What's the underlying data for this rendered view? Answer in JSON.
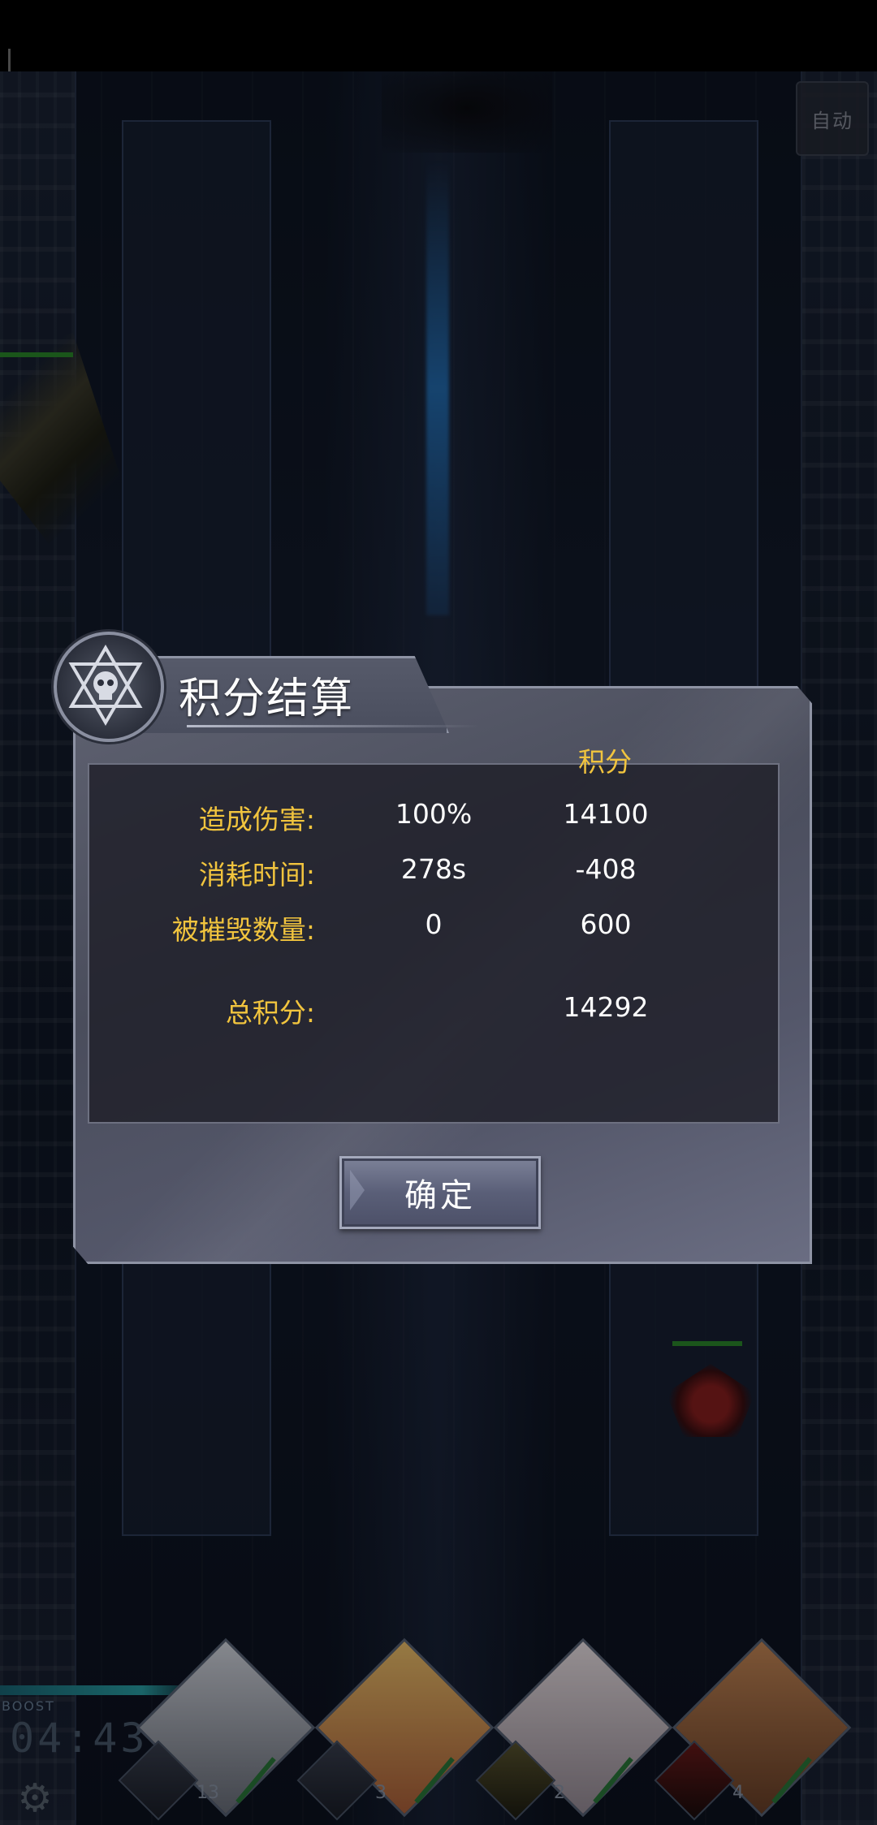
{
  "hud": {
    "auto_label": "自动",
    "boost_label": "BOOST",
    "timer": "04:43",
    "settings_icon": "gear-icon"
  },
  "party": [
    {
      "count": "13"
    },
    {
      "count": "3"
    },
    {
      "count": "2"
    },
    {
      "count": "4"
    }
  ],
  "dialog": {
    "title": "积分结算",
    "emblem_icon": "skull-hexagram-icon",
    "score_header": "积分",
    "rows": [
      {
        "label": "造成伤害:",
        "value": "100%",
        "score": "14100"
      },
      {
        "label": "消耗时间:",
        "value": "278s",
        "score": "-408"
      },
      {
        "label": "被摧毁数量:",
        "value": "0",
        "score": "600"
      }
    ],
    "total_label": "总积分:",
    "total_score": "14292",
    "confirm_label": "确定"
  },
  "colors": {
    "label_gold": "#f1c43e",
    "value_white": "#ffffff",
    "dialog_bg": "#4a4d5c"
  }
}
